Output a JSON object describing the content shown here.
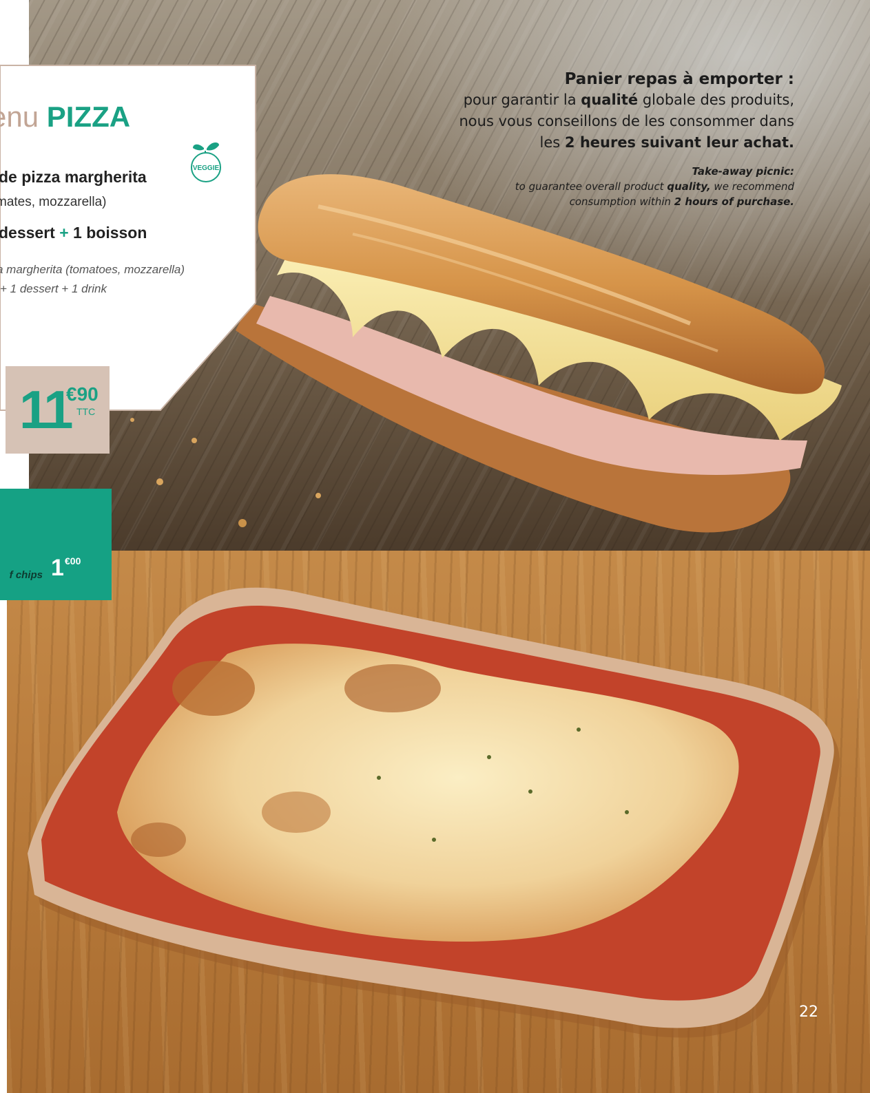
{
  "menu": {
    "title_prefix": "enu",
    "title_main": "PIZZA",
    "item_line": "de pizza margherita",
    "ingredients": "mates, mozzarella)",
    "extras_part1": "dessert",
    "extras_plus": "+",
    "extras_part2": "1 boisson",
    "english_line1": "a margherita (tomatoes, mozzarella)",
    "english_line2": "+ 1 dessert + 1 drink",
    "veggie_badge": "VEGGIE",
    "price_integer": "11",
    "price_cents": "€90",
    "price_tax_label": "TTC"
  },
  "chips": {
    "label": "f chips",
    "price_integer": "1",
    "price_cents": "€00"
  },
  "notice": {
    "title": "Panier repas à emporter :",
    "fr_line1_a": "pour garantir la ",
    "fr_line1_b": "qualité",
    "fr_line1_c": " globale des produits,",
    "fr_line2": "nous vous conseillons de les consommer dans",
    "fr_line3_a": "les ",
    "fr_line3_b": "2 heures suivant leur achat.",
    "en_line1": "Take-away picnic:",
    "en_line2_a": "to guarantee overall product ",
    "en_line2_b": "quality,",
    "en_line2_c": " we recommend",
    "en_line3_a": "consumption within ",
    "en_line3_b": "2 hours of purchase."
  },
  "page_number": "22",
  "colors": {
    "accent_green": "#1aa184",
    "accent_beige": "#c2a595",
    "price_box": "#d6c2b5"
  }
}
